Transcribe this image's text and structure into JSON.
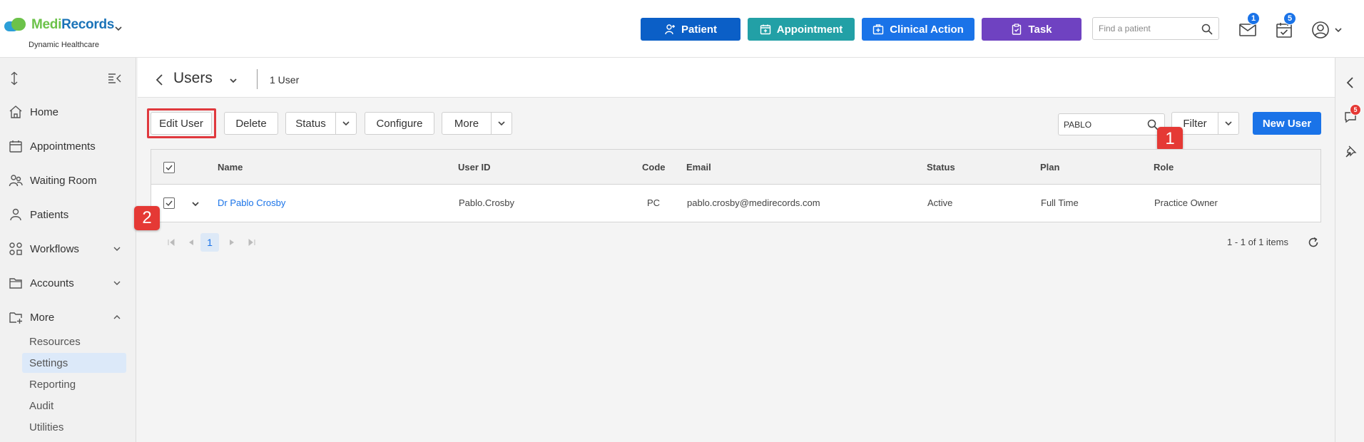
{
  "brand": {
    "name_part1": "Medi",
    "name_part2": "Records",
    "subtitle": "Dynamic Healthcare"
  },
  "header": {
    "quick_actions": [
      {
        "label": "Patient",
        "color": "#0b5fc7"
      },
      {
        "label": "Appointment",
        "color": "#22a0a6"
      },
      {
        "label": "Clinical Action",
        "color": "#1a73e8"
      },
      {
        "label": "Task",
        "color": "#6f42c1"
      }
    ],
    "find_placeholder": "Find a patient",
    "mail_badge": "1",
    "calendar_badge": "5"
  },
  "sidebar": {
    "items": [
      {
        "label": "Home",
        "icon": "home-icon"
      },
      {
        "label": "Appointments",
        "icon": "calendar-icon"
      },
      {
        "label": "Waiting Room",
        "icon": "people-icon"
      },
      {
        "label": "Patients",
        "icon": "person-icon"
      },
      {
        "label": "Workflows",
        "icon": "workflow-icon"
      },
      {
        "label": "Accounts",
        "icon": "folder-icon"
      },
      {
        "label": "More",
        "icon": "folder-plus-icon"
      }
    ],
    "more_subitems": [
      "Resources",
      "Settings",
      "Reporting",
      "Audit",
      "Utilities"
    ],
    "active_subitem": "Settings"
  },
  "page": {
    "title": "Users",
    "count_label": "1 User"
  },
  "toolbar": {
    "edit_label": "Edit User",
    "delete_label": "Delete",
    "status_label": "Status",
    "configure_label": "Configure",
    "more_label": "More",
    "search_value": "PABLO",
    "filter_label": "Filter",
    "new_user_label": "New User"
  },
  "steps": {
    "one": "1",
    "two": "2"
  },
  "table": {
    "columns": {
      "name": "Name",
      "user_id": "User ID",
      "code": "Code",
      "email": "Email",
      "status": "Status",
      "plan": "Plan",
      "role": "Role"
    },
    "rows": [
      {
        "name": "Dr Pablo Crosby",
        "user_id": "Pablo.Crosby",
        "code": "PC",
        "email": "pablo.crosby@medirecords.com",
        "status": "Active",
        "plan": "Full Time",
        "role": "Practice Owner"
      }
    ]
  },
  "pager": {
    "current_page": "1",
    "summary": "1 - 1 of 1 items"
  },
  "rail": {
    "notification_badge": "5"
  }
}
